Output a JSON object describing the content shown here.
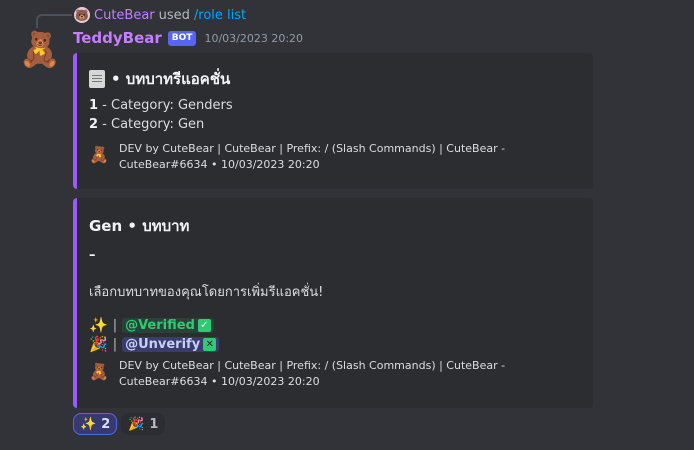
{
  "reply": {
    "username": "CuteBear",
    "used_text": "used",
    "command": "/role list"
  },
  "message": {
    "username": "TeddyBear",
    "bot_tag": "BOT",
    "timestamp": "10/03/2023 20:20"
  },
  "embed1": {
    "title": "• บทบาทรีแอคชั่น",
    "lines": [
      {
        "num": "1",
        "text": " - Category: Genders"
      },
      {
        "num": "2",
        "text": " - Category: Gen"
      }
    ],
    "footer_text": "DEV by CuteBear | CuteBear | Prefix: / (Slash Commands) | CuteBear - CuteBear#6634 • 10/03/2023 20:20"
  },
  "embed2": {
    "title": "Gen • บทบาท",
    "dash": "–",
    "description": "เลือกบทบาทของคุณโดยการเพิ่มรีแอคชั่น!",
    "roles": [
      {
        "emoji": "✨",
        "sep": "|",
        "mention": "@Verified",
        "badge": "✓"
      },
      {
        "emoji": "🎉",
        "sep": "|",
        "mention": "@Unverify",
        "badge": "✕"
      }
    ],
    "footer_text": "DEV by CuteBear | CuteBear | Prefix: / (Slash Commands) | CuteBear - CuteBear#6634 • 10/03/2023 20:20"
  },
  "reactions": [
    {
      "emoji": "✨",
      "count": "2",
      "active": true
    },
    {
      "emoji": "🎉",
      "count": "1",
      "active": false
    }
  ],
  "colors": {
    "embed_accent": "#9b59ff",
    "username": "#c77dff",
    "bot_tag": "#5865f2"
  },
  "icons": {
    "avatar": "teddy-bear-icon",
    "title_icon": "scroll-icon"
  }
}
